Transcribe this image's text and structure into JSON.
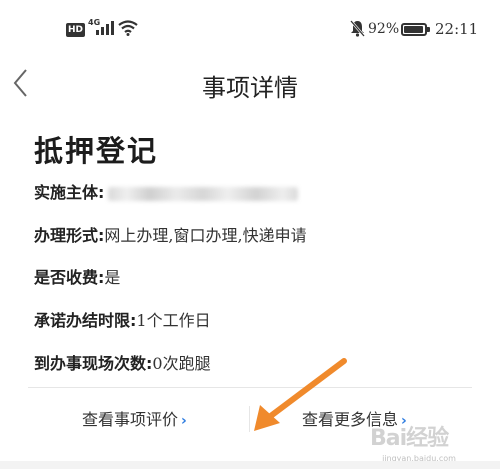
{
  "status_bar": {
    "hd": "HD",
    "network": "4G",
    "battery_percent": "92%",
    "battery_level": 0.92,
    "time": "22:11",
    "icons": [
      "hd-icon",
      "signal-icon",
      "wifi-icon",
      "mute-bell-icon",
      "battery-icon"
    ]
  },
  "header": {
    "title": "事项详情",
    "back_icon": "chevron-left-icon"
  },
  "detail": {
    "title": "抵押登记",
    "rows": [
      {
        "label": "实施主体:",
        "value": "",
        "redacted": true
      },
      {
        "label": "办理形式:",
        "value": "网上办理,窗口办理,快递申请"
      },
      {
        "label": "是否收费:",
        "value": "是"
      },
      {
        "label": "承诺办结时限:",
        "value": "1个工作日"
      },
      {
        "label": "到办事现场次数:",
        "value": "0次跑腿"
      }
    ]
  },
  "footer": {
    "left_link": "查看事项评价",
    "right_link": "查看更多信息"
  },
  "overlay": {
    "arrow_color": "#f08a2c",
    "watermark_text": "Bai经验",
    "watermark_sub": "jingyan.baidu.com"
  },
  "colors": {
    "accent": "#2c7be0",
    "text": "#222222",
    "divider": "#e6e6e6"
  }
}
